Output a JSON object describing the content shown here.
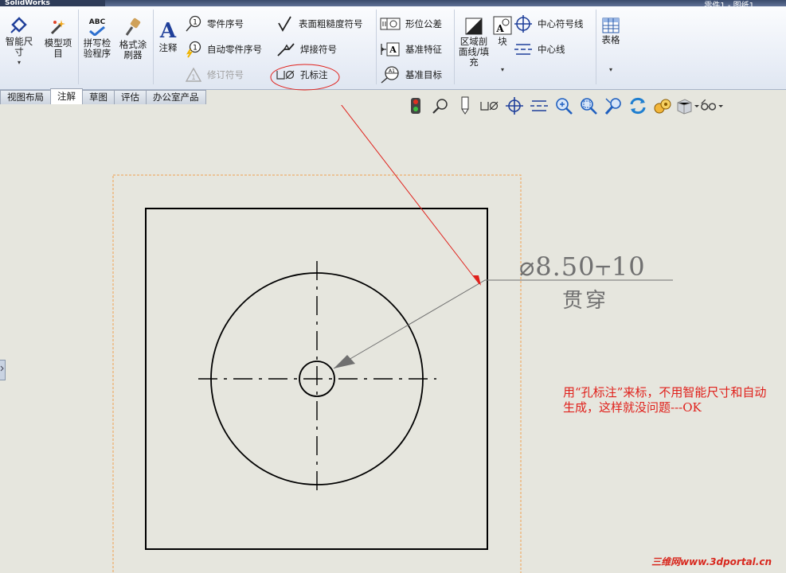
{
  "app": {
    "logo_text": "SolidWorks",
    "doc_title": "零件1 - 图纸1"
  },
  "ribbon": {
    "smart_dimension": "智能尺\n寸",
    "model_items": "模型项\n目",
    "spell_checker": "拼写检\n验程序",
    "spell_checker_icon_text": "ABC",
    "format_painter": "格式涂\n刷器",
    "note": "注释",
    "balloon": "零件序号",
    "auto_balloon": "自动零件序号",
    "revision_symbol": "修订符号",
    "surface_finish": "表面粗糙度符号",
    "weld_symbol": "焊接符号",
    "hole_callout": "孔标注",
    "geometric_tolerance": "形位公差",
    "datum_feature": "基准特征",
    "datum_target": "基准目标",
    "area_hatch": "区域剖\n面线/填\n充",
    "block": "块",
    "center_mark": "中心符号线",
    "centerline": "中心线",
    "table": "表格"
  },
  "tabs": [
    {
      "label": "视图布局",
      "active": false
    },
    {
      "label": "注解",
      "active": true
    },
    {
      "label": "草图",
      "active": false
    },
    {
      "label": "评估",
      "active": false
    },
    {
      "label": "办公室产品",
      "active": false
    }
  ],
  "drawing": {
    "callout_line1": "⌀8.50⫟10",
    "callout_line2": "贯穿",
    "note_text": "用“孔标注”来标，不用智能尺寸和自动生成，这样就没问题---OK"
  },
  "watermark": "三维网www.3dportal.cn",
  "colors": {
    "annotation_red": "#e0201b",
    "dimension_gray": "#707070",
    "bounding_orange": "#f0a050"
  }
}
